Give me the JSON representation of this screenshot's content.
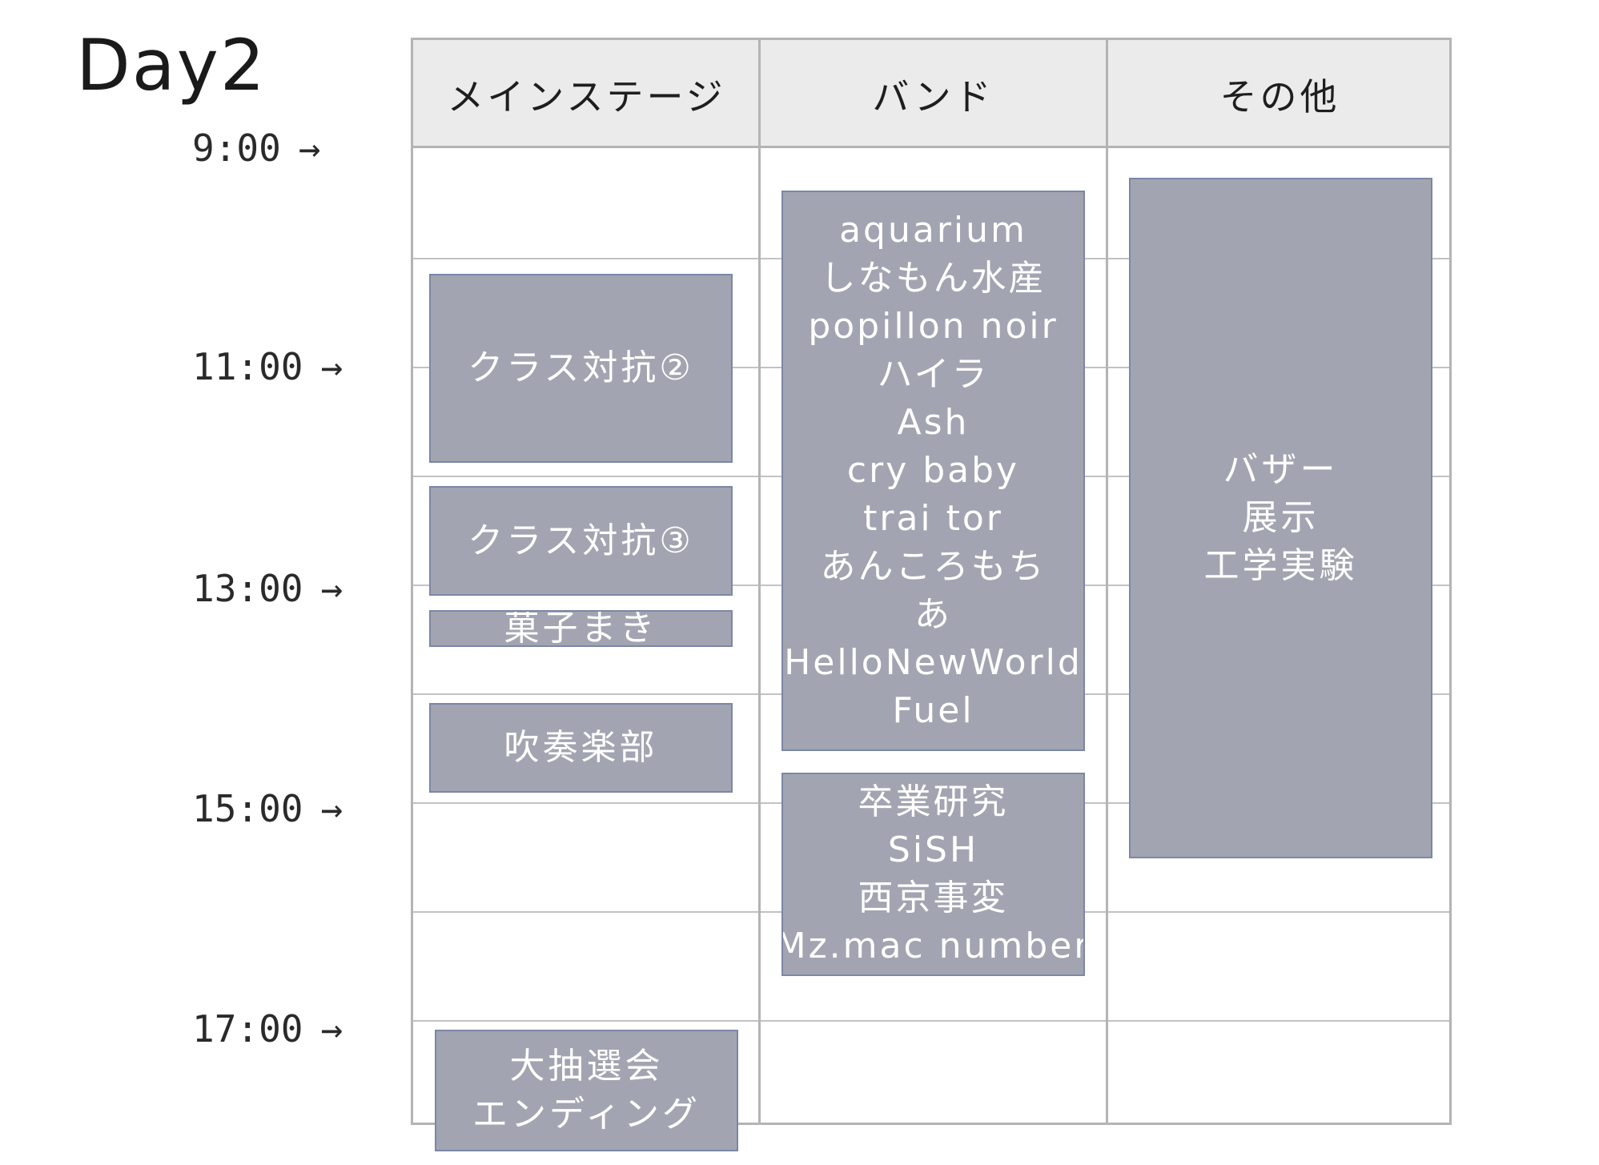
{
  "title": "Day2",
  "columns": [
    "メインステージ",
    "バンド",
    "その他"
  ],
  "times": [
    "9:00",
    "11:00",
    "13:00",
    "15:00",
    "17:00"
  ],
  "arrow": "→",
  "events": {
    "main": [
      {
        "lines": [
          "クラス対抗②"
        ]
      },
      {
        "lines": [
          "クラス対抗③"
        ]
      },
      {
        "lines": [
          "菓子まき"
        ]
      },
      {
        "lines": [
          "吹奏楽部"
        ]
      },
      {
        "lines": [
          "大抽選会",
          "エンディング"
        ]
      }
    ],
    "band": [
      {
        "lines": [
          "aquarium",
          "しなもん水産",
          "popillon noir",
          "ハイラ",
          "Ash",
          "cry baby",
          "trai tor",
          "あんころもち",
          "あ",
          "HelloNewWorld",
          "Fuel"
        ]
      },
      {
        "lines": [
          "卒業研究",
          "SiSH",
          "西京事変",
          "Mz.mac number"
        ]
      }
    ],
    "other": [
      {
        "lines": [
          "バザー",
          "展示",
          "工学実験"
        ]
      }
    ]
  },
  "colors": {
    "event_fill": "#a2a5b1",
    "event_border": "#7b87a6",
    "header_fill": "#ebebeb",
    "grid_line": "#b4b4b4",
    "event_text": "#ffffff"
  }
}
